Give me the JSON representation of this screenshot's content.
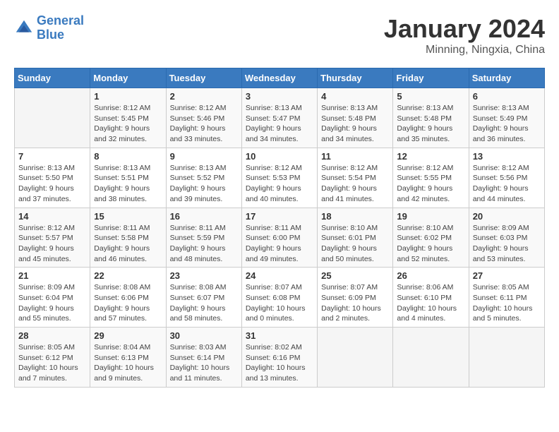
{
  "header": {
    "logo_line1": "General",
    "logo_line2": "Blue",
    "title": "January 2024",
    "subtitle": "Minning, Ningxia, China"
  },
  "weekdays": [
    "Sunday",
    "Monday",
    "Tuesday",
    "Wednesday",
    "Thursday",
    "Friday",
    "Saturday"
  ],
  "weeks": [
    [
      {
        "day": "",
        "info": ""
      },
      {
        "day": "1",
        "info": "Sunrise: 8:12 AM\nSunset: 5:45 PM\nDaylight: 9 hours\nand 32 minutes."
      },
      {
        "day": "2",
        "info": "Sunrise: 8:12 AM\nSunset: 5:46 PM\nDaylight: 9 hours\nand 33 minutes."
      },
      {
        "day": "3",
        "info": "Sunrise: 8:13 AM\nSunset: 5:47 PM\nDaylight: 9 hours\nand 34 minutes."
      },
      {
        "day": "4",
        "info": "Sunrise: 8:13 AM\nSunset: 5:48 PM\nDaylight: 9 hours\nand 34 minutes."
      },
      {
        "day": "5",
        "info": "Sunrise: 8:13 AM\nSunset: 5:48 PM\nDaylight: 9 hours\nand 35 minutes."
      },
      {
        "day": "6",
        "info": "Sunrise: 8:13 AM\nSunset: 5:49 PM\nDaylight: 9 hours\nand 36 minutes."
      }
    ],
    [
      {
        "day": "7",
        "info": "Sunrise: 8:13 AM\nSunset: 5:50 PM\nDaylight: 9 hours\nand 37 minutes."
      },
      {
        "day": "8",
        "info": "Sunrise: 8:13 AM\nSunset: 5:51 PM\nDaylight: 9 hours\nand 38 minutes."
      },
      {
        "day": "9",
        "info": "Sunrise: 8:13 AM\nSunset: 5:52 PM\nDaylight: 9 hours\nand 39 minutes."
      },
      {
        "day": "10",
        "info": "Sunrise: 8:12 AM\nSunset: 5:53 PM\nDaylight: 9 hours\nand 40 minutes."
      },
      {
        "day": "11",
        "info": "Sunrise: 8:12 AM\nSunset: 5:54 PM\nDaylight: 9 hours\nand 41 minutes."
      },
      {
        "day": "12",
        "info": "Sunrise: 8:12 AM\nSunset: 5:55 PM\nDaylight: 9 hours\nand 42 minutes."
      },
      {
        "day": "13",
        "info": "Sunrise: 8:12 AM\nSunset: 5:56 PM\nDaylight: 9 hours\nand 44 minutes."
      }
    ],
    [
      {
        "day": "14",
        "info": "Sunrise: 8:12 AM\nSunset: 5:57 PM\nDaylight: 9 hours\nand 45 minutes."
      },
      {
        "day": "15",
        "info": "Sunrise: 8:11 AM\nSunset: 5:58 PM\nDaylight: 9 hours\nand 46 minutes."
      },
      {
        "day": "16",
        "info": "Sunrise: 8:11 AM\nSunset: 5:59 PM\nDaylight: 9 hours\nand 48 minutes."
      },
      {
        "day": "17",
        "info": "Sunrise: 8:11 AM\nSunset: 6:00 PM\nDaylight: 9 hours\nand 49 minutes."
      },
      {
        "day": "18",
        "info": "Sunrise: 8:10 AM\nSunset: 6:01 PM\nDaylight: 9 hours\nand 50 minutes."
      },
      {
        "day": "19",
        "info": "Sunrise: 8:10 AM\nSunset: 6:02 PM\nDaylight: 9 hours\nand 52 minutes."
      },
      {
        "day": "20",
        "info": "Sunrise: 8:09 AM\nSunset: 6:03 PM\nDaylight: 9 hours\nand 53 minutes."
      }
    ],
    [
      {
        "day": "21",
        "info": "Sunrise: 8:09 AM\nSunset: 6:04 PM\nDaylight: 9 hours\nand 55 minutes."
      },
      {
        "day": "22",
        "info": "Sunrise: 8:08 AM\nSunset: 6:06 PM\nDaylight: 9 hours\nand 57 minutes."
      },
      {
        "day": "23",
        "info": "Sunrise: 8:08 AM\nSunset: 6:07 PM\nDaylight: 9 hours\nand 58 minutes."
      },
      {
        "day": "24",
        "info": "Sunrise: 8:07 AM\nSunset: 6:08 PM\nDaylight: 10 hours\nand 0 minutes."
      },
      {
        "day": "25",
        "info": "Sunrise: 8:07 AM\nSunset: 6:09 PM\nDaylight: 10 hours\nand 2 minutes."
      },
      {
        "day": "26",
        "info": "Sunrise: 8:06 AM\nSunset: 6:10 PM\nDaylight: 10 hours\nand 4 minutes."
      },
      {
        "day": "27",
        "info": "Sunrise: 8:05 AM\nSunset: 6:11 PM\nDaylight: 10 hours\nand 5 minutes."
      }
    ],
    [
      {
        "day": "28",
        "info": "Sunrise: 8:05 AM\nSunset: 6:12 PM\nDaylight: 10 hours\nand 7 minutes."
      },
      {
        "day": "29",
        "info": "Sunrise: 8:04 AM\nSunset: 6:13 PM\nDaylight: 10 hours\nand 9 minutes."
      },
      {
        "day": "30",
        "info": "Sunrise: 8:03 AM\nSunset: 6:14 PM\nDaylight: 10 hours\nand 11 minutes."
      },
      {
        "day": "31",
        "info": "Sunrise: 8:02 AM\nSunset: 6:16 PM\nDaylight: 10 hours\nand 13 minutes."
      },
      {
        "day": "",
        "info": ""
      },
      {
        "day": "",
        "info": ""
      },
      {
        "day": "",
        "info": ""
      }
    ]
  ]
}
